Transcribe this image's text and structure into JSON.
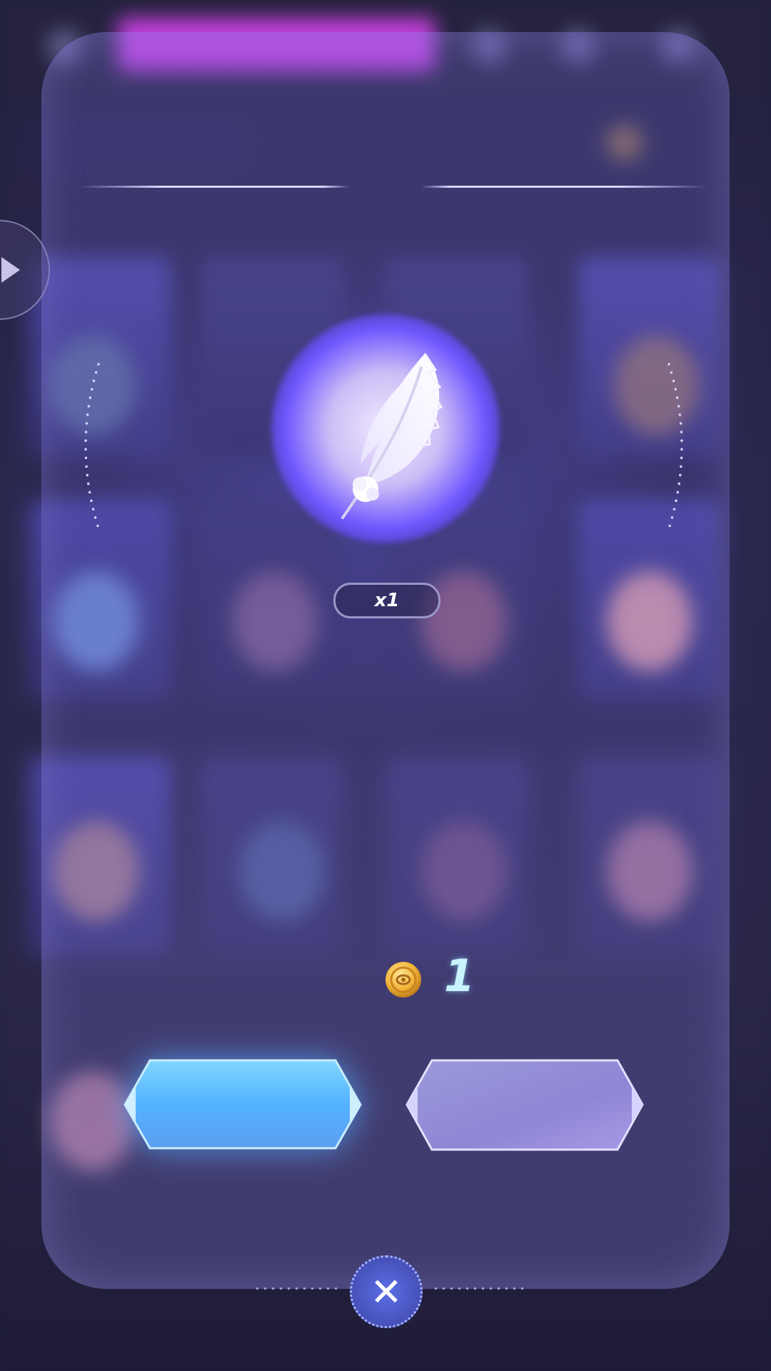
{
  "item": {
    "name_icon": "white-feather-icon",
    "quantity": "x1"
  },
  "cost": {
    "currency_icon": "gold-coin-icon",
    "amount": "1"
  },
  "buttons": {
    "confirm_label": "",
    "cancel_label": ""
  },
  "colors": {
    "confirm_button": "#5fbcff",
    "cancel_button": "#9c98e0",
    "cost_text": "#c9f3ff",
    "glow": "#6f57ff"
  }
}
